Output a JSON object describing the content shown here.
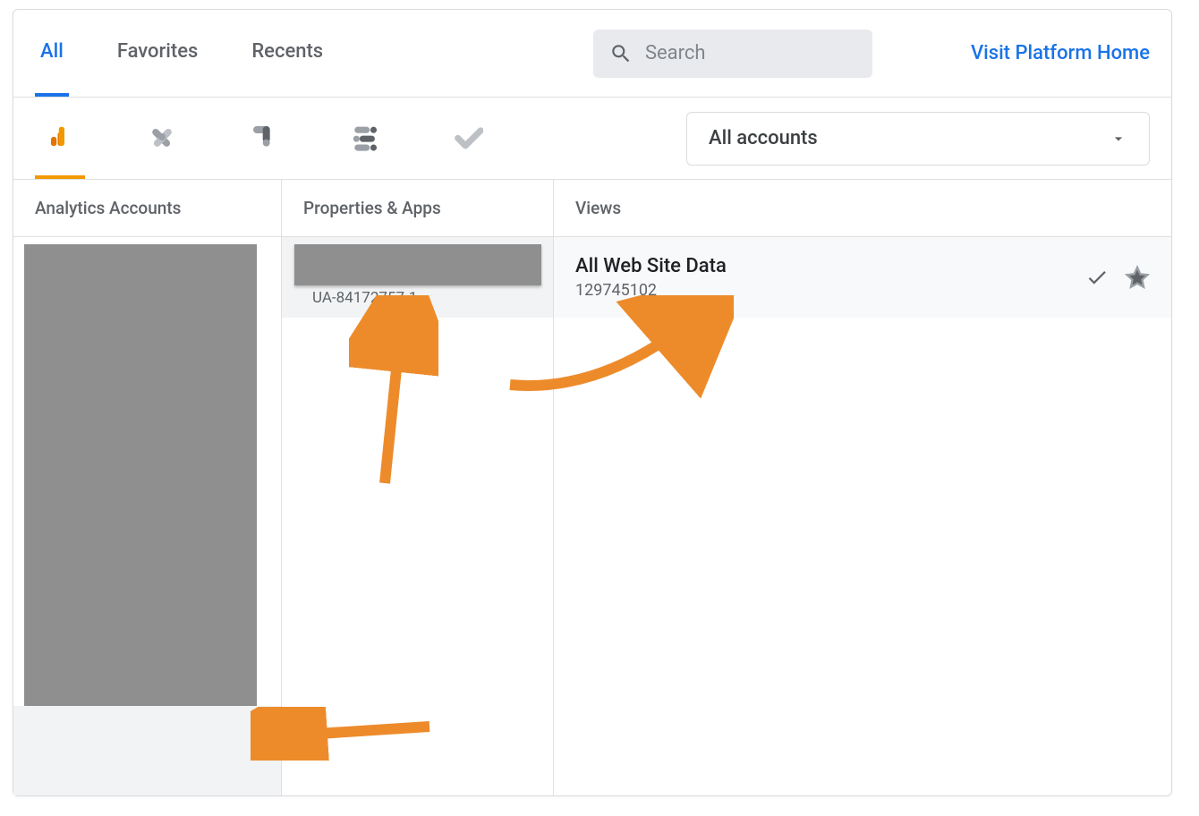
{
  "tabs": {
    "all": "All",
    "favorites": "Favorites",
    "recents": "Recents"
  },
  "search": {
    "placeholder": "Search"
  },
  "visit_link": "Visit Platform Home",
  "account_selector": {
    "label": "All accounts"
  },
  "columns": {
    "accounts_header": "Analytics Accounts",
    "properties_header": "Properties & Apps",
    "views_header": "Views"
  },
  "property": {
    "id": "UA-84172757-1"
  },
  "view": {
    "name": "All Web Site Data",
    "id": "129745102"
  },
  "icons": {
    "analytics": "analytics",
    "tagmanager": "tagmanager",
    "optimize": "optimize",
    "datastudio": "datastudio",
    "check": "check"
  }
}
